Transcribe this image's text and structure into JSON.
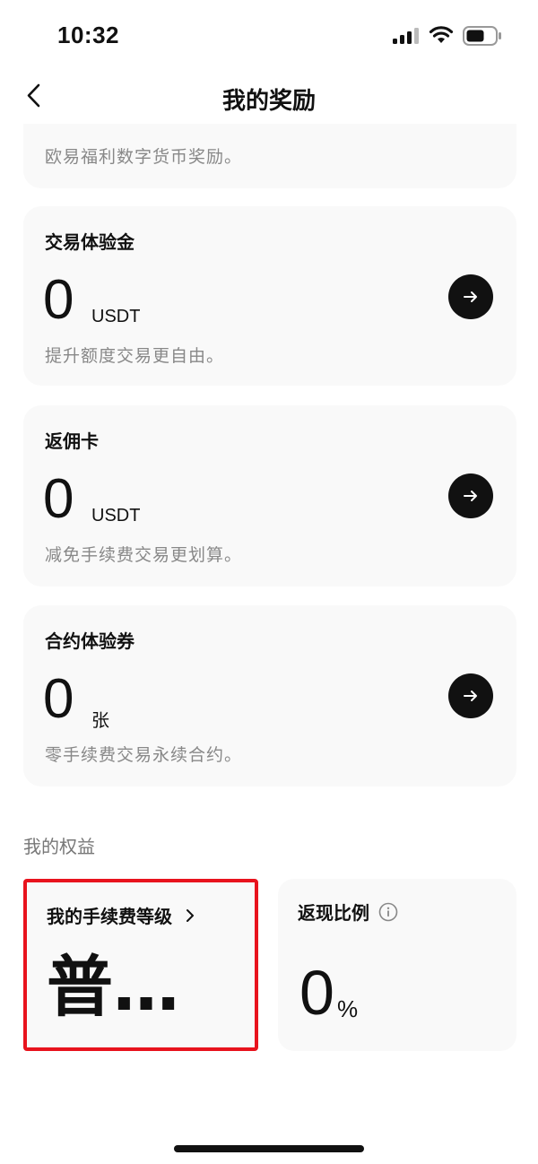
{
  "status_bar": {
    "time": "10:32"
  },
  "header": {
    "title": "我的奖励"
  },
  "cards": [
    {
      "description": "欧易福利数字货币奖励。"
    },
    {
      "title": "交易体验金",
      "value": "0",
      "unit": "USDT",
      "description": "提升额度交易更自由。"
    },
    {
      "title": "返佣卡",
      "value": "0",
      "unit": "USDT",
      "description": "减免手续费交易更划算。"
    },
    {
      "title": "合约体验券",
      "value": "0",
      "unit": "张",
      "description": "零手续费交易永续合约。"
    }
  ],
  "benefits": {
    "section_title": "我的权益",
    "fee_level": {
      "title": "我的手续费等级",
      "value": "普…"
    },
    "cashback": {
      "title": "返现比例",
      "value": "0",
      "unit": "%"
    }
  },
  "colors": {
    "highlight_border": "#e8131d",
    "card_bg": "#f9f9f9",
    "arrow_button": "#111111"
  }
}
